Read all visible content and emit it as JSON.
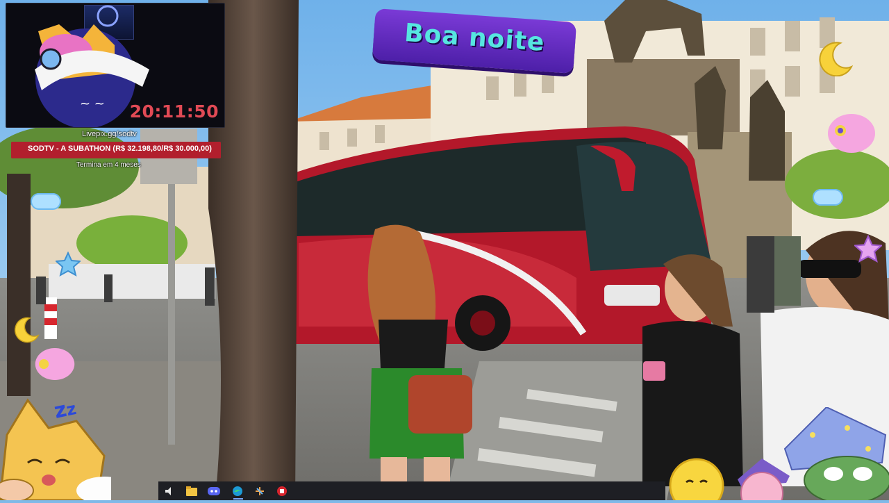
{
  "overlay": {
    "timer": "20:11:50",
    "donation_url": "Livepix.gg/sodtv",
    "goal_label": "SODTV - A SUBATHON (R$ 32.198,80/R$ 30.000,00)",
    "goal_progress": 1.0,
    "goal_subtext": "Termina em 4 meses",
    "banner_text": "Boa noite"
  },
  "taskbar": {
    "icons": [
      "speaker-icon",
      "file-explorer-icon",
      "discord-icon",
      "edge-icon",
      "tool-icon",
      "stream-app-icon"
    ]
  },
  "colors": {
    "goal_bar": "#b21f2d",
    "timer": "#e14a55",
    "banner_bg": "#6a2fc4",
    "banner_text": "#56e6e0",
    "bus": "#b3182a"
  }
}
